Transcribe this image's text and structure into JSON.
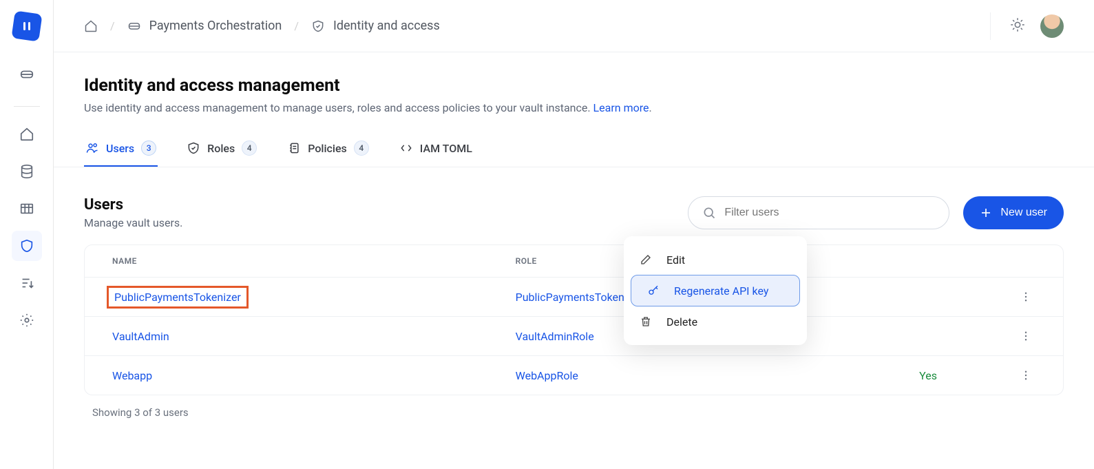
{
  "breadcrumbs": {
    "item1": "Payments Orchestration",
    "item2": "Identity and access"
  },
  "page": {
    "title": "Identity and access management",
    "description": "Use identity and access management to manage users, roles and access policies to your vault instance. ",
    "learn_more": "Learn more"
  },
  "tabs": {
    "users": {
      "label": "Users",
      "count": "3"
    },
    "roles": {
      "label": "Roles",
      "count": "4"
    },
    "policies": {
      "label": "Policies",
      "count": "4"
    },
    "iam_toml": {
      "label": "IAM TOML"
    }
  },
  "section": {
    "title": "Users",
    "subtitle": "Manage vault users.",
    "filter_placeholder": "Filter users",
    "new_user_btn": "New user"
  },
  "table": {
    "headers": {
      "name": "NAME",
      "role": "ROLE"
    },
    "rows": [
      {
        "name": "PublicPaymentsTokenizer",
        "role": "PublicPaymentsTokenizerRole",
        "extra": ""
      },
      {
        "name": "VaultAdmin",
        "role": "VaultAdminRole",
        "extra": ""
      },
      {
        "name": "Webapp",
        "role": "WebAppRole",
        "extra": "Yes"
      }
    ],
    "footer": "Showing 3 of 3 users"
  },
  "ctx_menu": {
    "edit": "Edit",
    "regen": "Regenerate API key",
    "delete": "Delete"
  }
}
